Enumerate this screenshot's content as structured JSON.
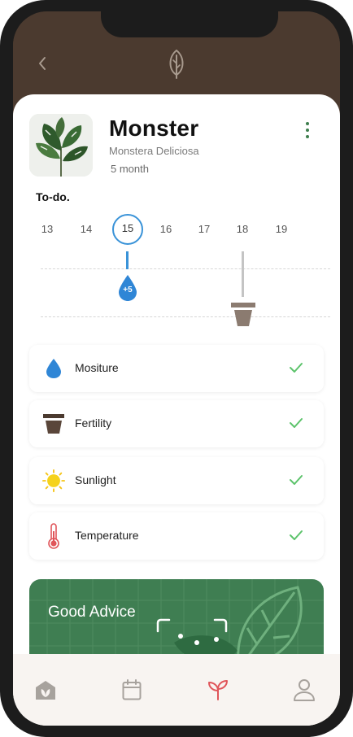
{
  "header": {
    "back_icon": "chevron-left-icon",
    "logo_icon": "leaf-icon",
    "background_color": "#4b3a2f"
  },
  "plant": {
    "name": "Monster",
    "species": "Monstera Deliciosa",
    "age": "5 month",
    "menu_icon": "more-vertical-icon"
  },
  "todo": {
    "title": "To-do.",
    "dates": [
      "13",
      "14",
      "15",
      "16",
      "17",
      "18",
      "19"
    ],
    "selected_date": "15",
    "water_badge": "+5",
    "accent_color": "#3a93d8"
  },
  "care": {
    "items": [
      {
        "label": "Mositure",
        "icon": "water-drop-icon",
        "status": "check-icon"
      },
      {
        "label": "Fertility",
        "icon": "plant-pot-icon",
        "status": "check-icon"
      },
      {
        "label": "Sunlight",
        "icon": "sun-icon",
        "status": "check-icon"
      },
      {
        "label": "Temperature",
        "icon": "thermometer-icon",
        "status": "check-icon"
      }
    ],
    "check_color": "#5cc36b"
  },
  "advice": {
    "title": "Good Advice",
    "background_color": "#3f7e52"
  },
  "tabbar": {
    "tabs": [
      {
        "name": "home",
        "icon": "home-leaf-icon",
        "active": false
      },
      {
        "name": "calendar",
        "icon": "calendar-icon",
        "active": false
      },
      {
        "name": "plants",
        "icon": "sprout-icon",
        "active": true
      },
      {
        "name": "profile",
        "icon": "user-icon",
        "active": false
      }
    ],
    "active_color": "#e0555a"
  }
}
